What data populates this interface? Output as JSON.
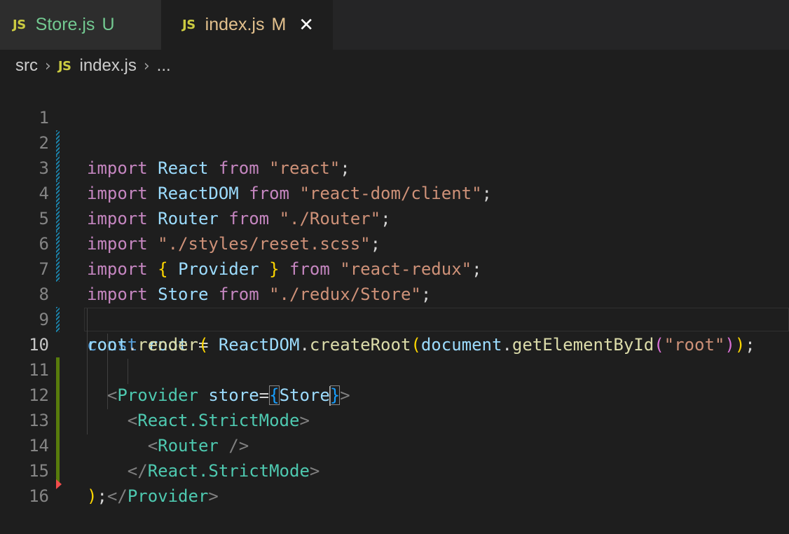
{
  "tabs": [
    {
      "icon": "JS",
      "label": "Store.js",
      "status": "U",
      "active": false
    },
    {
      "icon": "JS",
      "label": "index.js",
      "status": "M",
      "active": true,
      "close": "✕"
    }
  ],
  "breadcrumb": {
    "folder": "src",
    "icon": "JS",
    "file": "index.js",
    "more": "..."
  },
  "editor": {
    "lines": [
      {
        "n": "1",
        "tokens": [
          "import",
          " ",
          "React",
          " ",
          "from",
          " ",
          "\"react\"",
          ";"
        ]
      },
      {
        "n": "2",
        "tokens": [
          "import",
          " ",
          "ReactDOM",
          " ",
          "from",
          " ",
          "\"react-dom/client\"",
          ";"
        ]
      },
      {
        "n": "3",
        "tokens": [
          "import",
          " ",
          "Router",
          " ",
          "from",
          " ",
          "\"./Router\"",
          ";"
        ]
      },
      {
        "n": "4",
        "tokens": [
          "import",
          " ",
          "\"./styles/reset.scss\"",
          ";"
        ]
      },
      {
        "n": "5",
        "tokens": [
          "import",
          " ",
          "{",
          " ",
          "Provider",
          " ",
          "}",
          " ",
          "from",
          " ",
          "\"react-redux\"",
          ";"
        ]
      },
      {
        "n": "6",
        "tokens": [
          "import",
          " ",
          "Store",
          " ",
          "from",
          " ",
          "\"./redux/Store\"",
          ";"
        ]
      },
      {
        "n": "7",
        "tokens": []
      },
      {
        "n": "8",
        "tokens": [
          "const",
          " ",
          "root",
          " = ",
          "ReactDOM",
          ".",
          "createRoot",
          "(",
          "document",
          ".",
          "getElementById",
          "(",
          "\"root\"",
          ")",
          ")",
          ";"
        ]
      },
      {
        "n": "9",
        "tokens": [
          "root",
          ".",
          "render",
          "("
        ]
      },
      {
        "n": "10",
        "tokens": [
          "  ",
          "<",
          "Provider",
          " ",
          "store",
          "=",
          "{",
          "Store",
          "}",
          ">"
        ]
      },
      {
        "n": "11",
        "tokens": [
          "    ",
          "<",
          "React.StrictMode",
          ">"
        ]
      },
      {
        "n": "12",
        "tokens": [
          "      ",
          "<",
          "Router",
          " ",
          "/>"
        ]
      },
      {
        "n": "13",
        "tokens": [
          "    ",
          "</",
          "React.StrictMode",
          ">"
        ]
      },
      {
        "n": "14",
        "tokens": [
          "  ",
          "</",
          "Provider",
          ">"
        ]
      },
      {
        "n": "15",
        "tokens": [
          ")",
          ";"
        ]
      },
      {
        "n": "16",
        "tokens": []
      }
    ]
  }
}
